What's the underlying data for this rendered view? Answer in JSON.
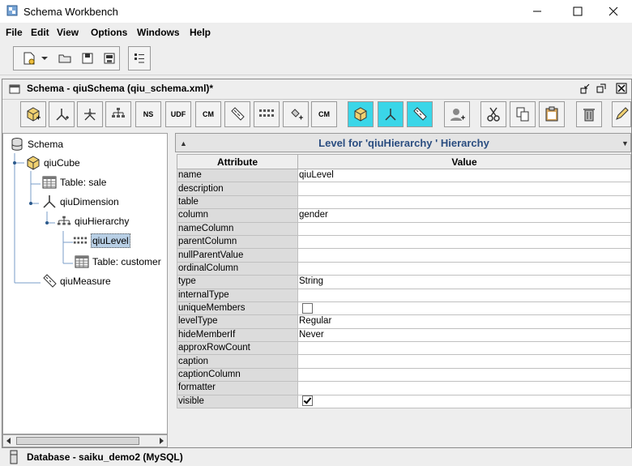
{
  "window": {
    "title": "Schema Workbench"
  },
  "menubar": {
    "items": [
      "File",
      "Edit",
      "View",
      "Options",
      "Windows",
      "Help"
    ]
  },
  "internal": {
    "title": "Schema - qiuSchema (qiu_schema.xml)*"
  },
  "schema_toolbar": {
    "text_labels": {
      "ns": "NS",
      "udf": "UDF",
      "cm1": "CM",
      "cm2": "CM"
    }
  },
  "tree": {
    "schema": "Schema",
    "cube": "qiuCube",
    "table_sale": "Table: sale",
    "dimension": "qiuDimension",
    "hierarchy": "qiuHierarchy",
    "level": "qiuLevel",
    "table_customer": "Table: customer",
    "measure": "qiuMeasure"
  },
  "level_panel": {
    "header": "Level for 'qiuHierarchy ' Hierarchy",
    "columns": {
      "attribute": "Attribute",
      "value": "Value"
    },
    "rows": [
      {
        "attr": "name",
        "value": "qiuLevel"
      },
      {
        "attr": "description",
        "value": ""
      },
      {
        "attr": "table",
        "value": ""
      },
      {
        "attr": "column",
        "value": "gender"
      },
      {
        "attr": "nameColumn",
        "value": ""
      },
      {
        "attr": "parentColumn",
        "value": ""
      },
      {
        "attr": "nullParentValue",
        "value": ""
      },
      {
        "attr": "ordinalColumn",
        "value": ""
      },
      {
        "attr": "type",
        "value": "String"
      },
      {
        "attr": "internalType",
        "value": ""
      },
      {
        "attr": "uniqueMembers",
        "value": "",
        "checkbox": false
      },
      {
        "attr": "levelType",
        "value": "Regular"
      },
      {
        "attr": "hideMemberIf",
        "value": "Never"
      },
      {
        "attr": "approxRowCount",
        "value": ""
      },
      {
        "attr": "caption",
        "value": ""
      },
      {
        "attr": "captionColumn",
        "value": ""
      },
      {
        "attr": "formatter",
        "value": ""
      },
      {
        "attr": "visible",
        "value": "",
        "checkbox": true
      }
    ]
  },
  "status": {
    "database": "Database - saiku_demo2 (MySQL)"
  },
  "colors": {
    "selection": "#b8cfe5",
    "header_text": "#2a4d80",
    "cyan_button": "#3ad6e8"
  }
}
